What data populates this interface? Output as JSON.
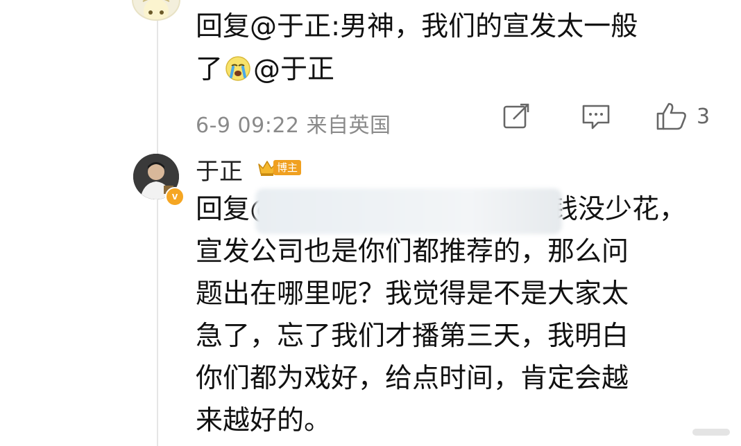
{
  "comment1": {
    "reply_prefix": "回复@于正:男神，我们的宣发太一般",
    "reply_suffix": "了",
    "mention": "@于正",
    "timestamp": "6-9 09:22",
    "source": "来自英国",
    "like_count": "3"
  },
  "comment2": {
    "username": "于正",
    "badge_label": "博主",
    "vbadge": "v",
    "reply_start": "回复@",
    "reply_text": "钱没少花，\n宣发公司也是你们都推荐的，那么问\n题出在哪里呢？我觉得是不是大家太\n急了，忘了我们才播第三天，我明白\n你们都为戏好，给点时间，肯定会越\n来越好的。"
  },
  "colors": {
    "badge": "#f0a020",
    "meta_text": "#8a8a8a",
    "thread_line": "#e6e6e6"
  }
}
